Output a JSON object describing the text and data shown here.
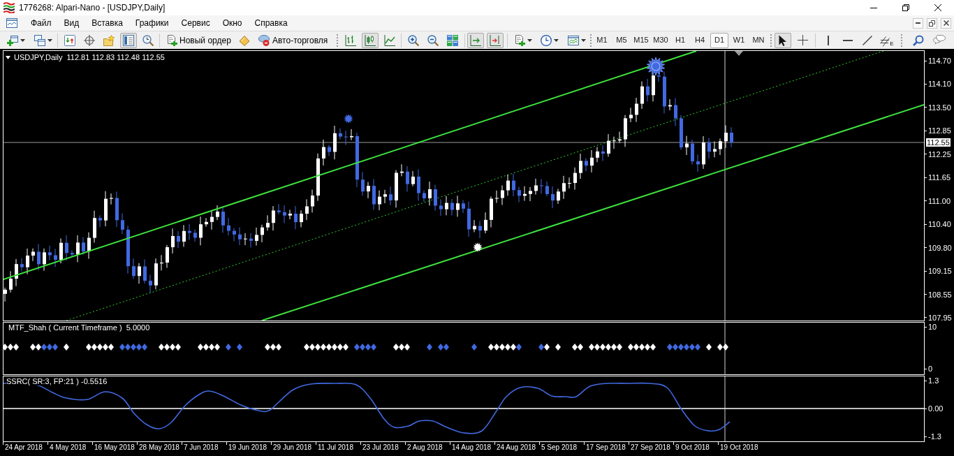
{
  "window": {
    "title": "1776268: Alpari-Nano - [USDJPY,Daily]"
  },
  "menu": [
    "Файл",
    "Вид",
    "Вставка",
    "Графики",
    "Сервис",
    "Окно",
    "Справка"
  ],
  "toolbar": {
    "window_tools": [
      {
        "on": false
      },
      {
        "on": false
      },
      {
        "on": false
      },
      {
        "on": true
      },
      {
        "on": false
      }
    ],
    "new_order": "Новый ордер",
    "autotrading": "Авто-торговля",
    "chart_types": [
      {
        "selected": false
      },
      {
        "selected": true
      },
      {
        "selected": false
      }
    ],
    "auto_scroll": {
      "on": true
    },
    "chart_shift": {
      "on": true
    },
    "timeframes": [
      {
        "label": "M1",
        "selected": false
      },
      {
        "label": "M5",
        "selected": false
      },
      {
        "label": "M15",
        "selected": false
      },
      {
        "label": "M30",
        "selected": false
      },
      {
        "label": "H1",
        "selected": false
      },
      {
        "label": "H4",
        "selected": false
      },
      {
        "label": "D1",
        "selected": true
      },
      {
        "label": "W1",
        "selected": false
      },
      {
        "label": "MN",
        "selected": false
      }
    ],
    "cursor_modes": [
      {
        "selected": true
      },
      {
        "selected": false
      }
    ],
    "channel_tool": "E"
  },
  "chart": {
    "symbol": "USDJPY,Daily",
    "ohlc": "112.81 112.83 112.48 112.55",
    "price_ticks": [
      "114.70",
      "114.10",
      "113.50",
      "112.85",
      "112.25",
      "111.65",
      "111.00",
      "110.40",
      "109.80",
      "109.15",
      "108.55",
      "107.95"
    ],
    "current_price": "112.55"
  },
  "indicators": [
    {
      "kind": "signals",
      "label": "MTF_Shah ( Current Timeframe )  5.0000",
      "ticks": [
        "10",
        "0"
      ]
    },
    {
      "kind": "oscillator",
      "label": "SSRC( SR:3, FP:21 ) -0.5516",
      "ticks": [
        "1.3",
        "0.00",
        "-1.3"
      ]
    }
  ],
  "dates": [
    "24 Apr 2018",
    "4 May 2018",
    "16 May 2018",
    "28 May 2018",
    "7 Jun 2018",
    "19 Jun 2018",
    "29 Jun 2018",
    "11 Jul 2018",
    "23 Jul 2018",
    "2 Aug 2018",
    "14 Aug 2018",
    "24 Aug 2018",
    "5 Sep 2018",
    "17 Sep 2018",
    "27 Sep 2018",
    "9 Oct 2018",
    "19 Oct 2018"
  ]
}
